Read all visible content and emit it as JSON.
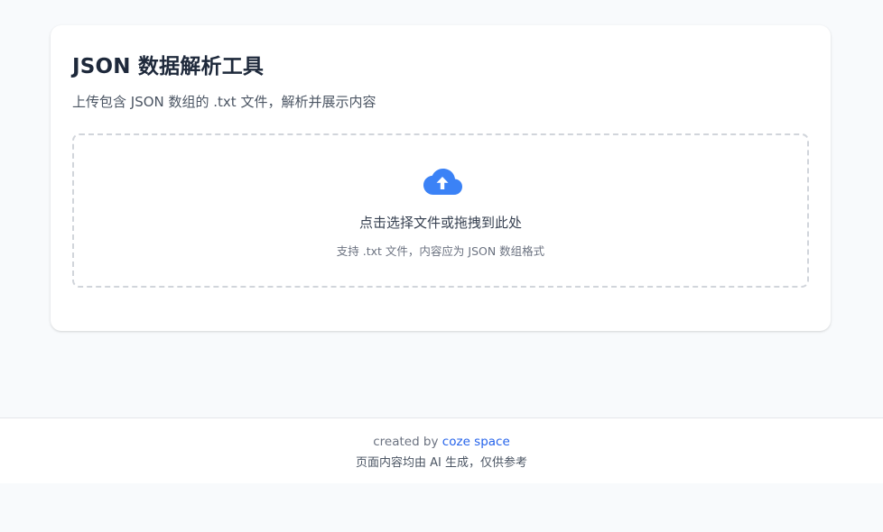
{
  "card": {
    "title": "JSON 数据解析工具",
    "subtitle": "上传包含 JSON 数组的 .txt 文件，解析并展示内容"
  },
  "dropzone": {
    "icon": "cloud-upload-icon",
    "main_text": "点击选择文件或拖拽到此处",
    "hint_text": "支持 .txt 文件，内容应为 JSON 数组格式"
  },
  "footer": {
    "created_by_prefix": "created by",
    "link_text": "coze space",
    "disclaimer": "页面内容均由 AI 生成，仅供参考"
  },
  "colors": {
    "accent": "#3b82f6",
    "link": "#2563eb",
    "background": "#f8fafc"
  }
}
